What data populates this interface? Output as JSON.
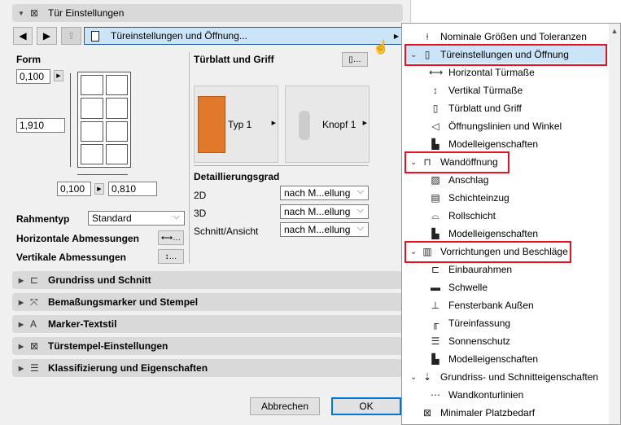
{
  "header": {
    "title": "Tür Einstellungen"
  },
  "nav": {
    "current": "Türeinstellungen und Öffnung..."
  },
  "form": {
    "label": "Form",
    "top_value": "0,100",
    "height_value": "1,910",
    "left_value": "0,100",
    "width_value": "0,810",
    "frame_type_label": "Rahmentyp",
    "frame_type_value": "Standard",
    "horizontal_label": "Horizontale Abmessungen",
    "vertical_label": "Vertikale Abmessungen"
  },
  "leaf": {
    "title": "Türblatt und Griff",
    "leaf_type": "Typ 1",
    "handle_type": "Knopf 1"
  },
  "detail": {
    "title": "Detaillierungsgrad",
    "rows": [
      {
        "label": "2D",
        "value": "nach M...ellung"
      },
      {
        "label": "3D",
        "value": "nach M...ellung"
      },
      {
        "label": "Schnitt/Ansicht",
        "value": "nach M...ellung"
      }
    ]
  },
  "sections": [
    "Grundriss und Schnitt",
    "Bemaßungsmarker und Stempel",
    "Marker-Textstil",
    "Türstempel-Einstellungen",
    "Klassifizierung und Eigenschaften"
  ],
  "footer": {
    "cancel": "Abbrechen",
    "ok": "OK"
  },
  "menu": [
    {
      "label": "Nominale Größen und Toleranzen",
      "level": 0,
      "icon": "⍿"
    },
    {
      "label": "Türeinstellungen und Öffnung",
      "level": 0,
      "icon": "▯",
      "expanded": true,
      "selected": true
    },
    {
      "label": "Horizontal Türmaße",
      "level": 1,
      "icon": "⟷"
    },
    {
      "label": "Vertikal Türmaße",
      "level": 1,
      "icon": "↕"
    },
    {
      "label": "Türblatt und Griff",
      "level": 1,
      "icon": "▯"
    },
    {
      "label": "Öffnungslinien und Winkel",
      "level": 1,
      "icon": "◁"
    },
    {
      "label": "Modelleigenschaften",
      "level": 1,
      "icon": "▙"
    },
    {
      "label": "Wandöffnung",
      "level": 0,
      "icon": "⊓",
      "expanded": true
    },
    {
      "label": "Anschlag",
      "level": 1,
      "icon": "▨"
    },
    {
      "label": "Schichteinzug",
      "level": 1,
      "icon": "▤"
    },
    {
      "label": "Rollschicht",
      "level": 1,
      "icon": "⌓"
    },
    {
      "label": "Modelleigenschaften",
      "level": 1,
      "icon": "▙"
    },
    {
      "label": "Vorrichtungen und Beschläge",
      "level": 0,
      "icon": "▥",
      "expanded": true
    },
    {
      "label": "Einbaurahmen",
      "level": 1,
      "icon": "⊏"
    },
    {
      "label": "Schwelle",
      "level": 1,
      "icon": "▬"
    },
    {
      "label": "Fensterbank Außen",
      "level": 1,
      "icon": "⊥"
    },
    {
      "label": "Türeinfassung",
      "level": 1,
      "icon": "╓"
    },
    {
      "label": "Sonnenschutz",
      "level": 1,
      "icon": "☰"
    },
    {
      "label": "Modelleigenschaften",
      "level": 1,
      "icon": "▙"
    },
    {
      "label": "Grundriss- und Schnitteigenschaften",
      "level": 0,
      "icon": "⇣",
      "expanded": true
    },
    {
      "label": "Wandkonturlinien",
      "level": 1,
      "icon": "⋯"
    },
    {
      "label": "Minimaler Platzbedarf",
      "level": 0,
      "icon": "⊠"
    }
  ]
}
